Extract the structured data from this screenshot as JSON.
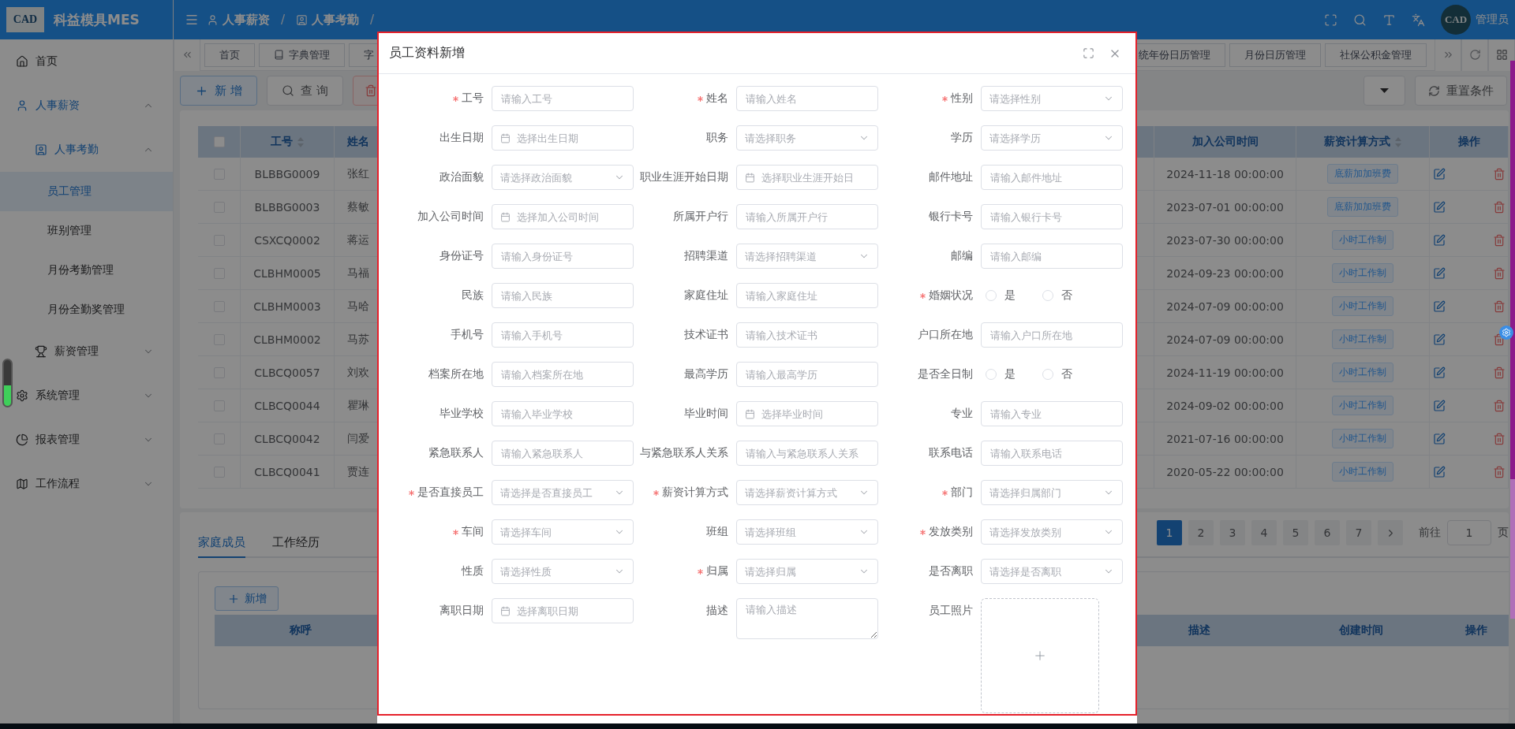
{
  "header": {
    "logo_text": "CAD",
    "app_title": "科益模具MES",
    "breadcrumb": [
      {
        "label": "人事薪资"
      },
      {
        "label": "人事考勤"
      }
    ],
    "breadcrumb_separators": [
      "/",
      "/"
    ],
    "avatar_text": "CAD",
    "user_name": "管理员"
  },
  "sidebar": {
    "items": [
      {
        "label": "首页",
        "selected": false
      },
      {
        "label": "人事薪资",
        "selected": false,
        "expanded": true,
        "children": [
          {
            "label": "人事考勤",
            "selected": false,
            "expanded": true,
            "children": [
              {
                "label": "员工管理",
                "selected": true
              },
              {
                "label": "班别管理",
                "selected": false
              },
              {
                "label": "月份考勤管理",
                "selected": false
              },
              {
                "label": "月份全勤奖管理",
                "selected": false
              }
            ]
          },
          {
            "label": "薪资管理",
            "selected": false,
            "expanded": false
          }
        ]
      },
      {
        "label": "系统管理",
        "selected": false,
        "expanded": false
      },
      {
        "label": "报表管理",
        "selected": false,
        "expanded": false
      },
      {
        "label": "工作流程",
        "selected": false,
        "expanded": false
      }
    ]
  },
  "tabs_left": [
    {
      "label": "首页",
      "kind": "plain",
      "selected": false
    },
    {
      "label": "字典管理",
      "kind": "icon",
      "selected": false
    },
    {
      "label": "字",
      "kind": "plain",
      "selected": false
    }
  ],
  "tabs_right": [
    {
      "label": "统年份日历管理",
      "selected": false
    },
    {
      "label": "月份日历管理",
      "selected": false
    },
    {
      "label": "社保公积金管理",
      "selected": false
    }
  ],
  "toolbar": {
    "buttons": [
      {
        "kind": "add",
        "label": "新 增"
      },
      {
        "kind": "search",
        "label": "查 询"
      },
      {
        "kind": "delete"
      }
    ],
    "right_buttons": [
      {
        "kind": "dropdown"
      },
      {
        "kind": "reset",
        "label": "重置条件"
      }
    ]
  },
  "table": {
    "select_all_checked": false,
    "columns": [
      {
        "label": "工号",
        "sortable": true
      },
      {
        "label": "姓名",
        "sortable": false
      },
      {
        "label": "加入公司时间",
        "sortable": false
      },
      {
        "label": "薪资计算方式",
        "sortable": true
      },
      {
        "label": "操作",
        "sortable": false
      }
    ],
    "rows": [
      {
        "checked": false,
        "id": "BLBBG0009",
        "name": "张红",
        "joined": "2024-11-18 00:00:00",
        "pay_type": "底薪加加班费"
      },
      {
        "checked": false,
        "id": "BLBBG0003",
        "name": "蔡敏",
        "joined": "2023-07-01 00:00:00",
        "pay_type": "底薪加加班费"
      },
      {
        "checked": false,
        "id": "CSXCQ0002",
        "name": "蒋运",
        "joined": "2023-07-30 00:00:00",
        "pay_type": "小时工作制"
      },
      {
        "checked": false,
        "id": "CLBHM0005",
        "name": "马福",
        "joined": "2024-09-23 00:00:00",
        "pay_type": "小时工作制"
      },
      {
        "checked": false,
        "id": "CLBHM0003",
        "name": "马哈",
        "joined": "2024-07-09 00:00:00",
        "pay_type": "小时工作制"
      },
      {
        "checked": false,
        "id": "CLBHM0002",
        "name": "马苏",
        "joined": "2024-07-09 00:00:00",
        "pay_type": "小时工作制"
      },
      {
        "checked": false,
        "id": "CLBCQ0057",
        "name": "刘欢",
        "joined": "2024-11-19 00:00:00",
        "pay_type": "小时工作制"
      },
      {
        "checked": false,
        "id": "CLBCQ0044",
        "name": "瞿琳",
        "joined": "2024-09-02 00:00:00",
        "pay_type": "小时工作制"
      },
      {
        "checked": false,
        "id": "CLBCQ0042",
        "name": "闫爱",
        "joined": "2021-07-16 00:00:00",
        "pay_type": "小时工作制"
      },
      {
        "checked": false,
        "id": "CLBCQ0041",
        "name": "贾连",
        "joined": "2020-05-22 00:00:00",
        "pay_type": "小时工作制"
      }
    ]
  },
  "pagination": {
    "pages": [
      {
        "label": "1",
        "selected": true
      },
      {
        "label": "2",
        "selected": false
      },
      {
        "label": "3",
        "selected": false
      },
      {
        "label": "4",
        "selected": false
      },
      {
        "label": "5",
        "selected": false
      },
      {
        "label": "6",
        "selected": false
      },
      {
        "label": "7",
        "selected": false
      }
    ],
    "goto_label": "前往",
    "goto_value": "1",
    "page_suffix": "页"
  },
  "detail_panel": {
    "tabs": [
      {
        "label": "家庭成员",
        "selected": true
      },
      {
        "label": "工作经历",
        "selected": false
      }
    ],
    "add_button": "新增",
    "columns": [
      "称呼",
      "描述",
      "创建时间",
      "操作"
    ]
  },
  "dialog": {
    "title": "员工资料新增",
    "fields": [
      {
        "label": "工号",
        "required": true,
        "kind": "input",
        "placeholder": "请输入工号"
      },
      {
        "label": "姓名",
        "required": true,
        "kind": "input",
        "placeholder": "请输入姓名"
      },
      {
        "label": "性别",
        "required": true,
        "kind": "select",
        "placeholder": "请选择性别"
      },
      {
        "label": "出生日期",
        "required": false,
        "kind": "date",
        "placeholder": "选择出生日期"
      },
      {
        "label": "职务",
        "required": false,
        "kind": "select",
        "placeholder": "请选择职务"
      },
      {
        "label": "学历",
        "required": false,
        "kind": "select",
        "placeholder": "请选择学历"
      },
      {
        "label": "政治面貌",
        "required": false,
        "kind": "select",
        "placeholder": "请选择政治面貌"
      },
      {
        "label": "职业生涯开始日期",
        "required": false,
        "kind": "date",
        "placeholder": "选择职业生涯开始日"
      },
      {
        "label": "邮件地址",
        "required": false,
        "kind": "input",
        "placeholder": "请输入邮件地址"
      },
      {
        "label": "加入公司时间",
        "required": false,
        "kind": "date",
        "placeholder": "选择加入公司时间"
      },
      {
        "label": "所属开户行",
        "required": false,
        "kind": "input",
        "placeholder": "请输入所属开户行"
      },
      {
        "label": "银行卡号",
        "required": false,
        "kind": "input",
        "placeholder": "请输入银行卡号"
      },
      {
        "label": "身份证号",
        "required": false,
        "kind": "input",
        "placeholder": "请输入身份证号"
      },
      {
        "label": "招聘渠道",
        "required": false,
        "kind": "select",
        "placeholder": "请选择招聘渠道"
      },
      {
        "label": "邮编",
        "required": false,
        "kind": "input",
        "placeholder": "请输入邮编"
      },
      {
        "label": "民族",
        "required": false,
        "kind": "input",
        "placeholder": "请输入民族"
      },
      {
        "label": "家庭住址",
        "required": false,
        "kind": "input",
        "placeholder": "请输入家庭住址"
      },
      {
        "label": "婚姻状况",
        "required": true,
        "kind": "radio",
        "options": [
          {
            "label": "是",
            "selected": false
          },
          {
            "label": "否",
            "selected": false
          }
        ]
      },
      {
        "label": "手机号",
        "required": false,
        "kind": "input",
        "placeholder": "请输入手机号"
      },
      {
        "label": "技术证书",
        "required": false,
        "kind": "input",
        "placeholder": "请输入技术证书"
      },
      {
        "label": "户口所在地",
        "required": false,
        "kind": "input",
        "placeholder": "请输入户口所在地"
      },
      {
        "label": "档案所在地",
        "required": false,
        "kind": "input",
        "placeholder": "请输入档案所在地"
      },
      {
        "label": "最高学历",
        "required": false,
        "kind": "input",
        "placeholder": "请输入最高学历"
      },
      {
        "label": "是否全日制",
        "required": false,
        "kind": "radio",
        "options": [
          {
            "label": "是",
            "selected": false
          },
          {
            "label": "否",
            "selected": false
          }
        ]
      },
      {
        "label": "毕业学校",
        "required": false,
        "kind": "input",
        "placeholder": "请输入毕业学校"
      },
      {
        "label": "毕业时间",
        "required": false,
        "kind": "date",
        "placeholder": "选择毕业时间"
      },
      {
        "label": "专业",
        "required": false,
        "kind": "input",
        "placeholder": "请输入专业"
      },
      {
        "label": "紧急联系人",
        "required": false,
        "kind": "input",
        "placeholder": "请输入紧急联系人"
      },
      {
        "label": "与紧急联系人关系",
        "required": false,
        "kind": "input",
        "placeholder": "请输入与紧急联系人关系"
      },
      {
        "label": "联系电话",
        "required": false,
        "kind": "input",
        "placeholder": "请输入联系电话"
      },
      {
        "label": "是否直接员工",
        "required": true,
        "kind": "select",
        "placeholder": "请选择是否直接员工"
      },
      {
        "label": "薪资计算方式",
        "required": true,
        "kind": "select",
        "placeholder": "请选择薪资计算方式"
      },
      {
        "label": "部门",
        "required": true,
        "kind": "select",
        "placeholder": "请选择归属部门"
      },
      {
        "label": "车间",
        "required": true,
        "kind": "select",
        "placeholder": "请选择车间"
      },
      {
        "label": "班组",
        "required": false,
        "kind": "select",
        "placeholder": "请选择班组"
      },
      {
        "label": "发放类别",
        "required": true,
        "kind": "select",
        "placeholder": "请选择发放类别"
      },
      {
        "label": "性质",
        "required": false,
        "kind": "select",
        "placeholder": "请选择性质"
      },
      {
        "label": "归属",
        "required": true,
        "kind": "select",
        "placeholder": "请选择归属"
      },
      {
        "label": "是否离职",
        "required": false,
        "kind": "select",
        "placeholder": "请选择是否离职"
      },
      {
        "label": "离职日期",
        "required": false,
        "kind": "date",
        "placeholder": "选择离职日期"
      },
      {
        "label": "描述",
        "required": false,
        "kind": "textarea",
        "placeholder": "请输入描述"
      },
      {
        "label": "员工照片",
        "required": false,
        "kind": "upload"
      }
    ]
  }
}
